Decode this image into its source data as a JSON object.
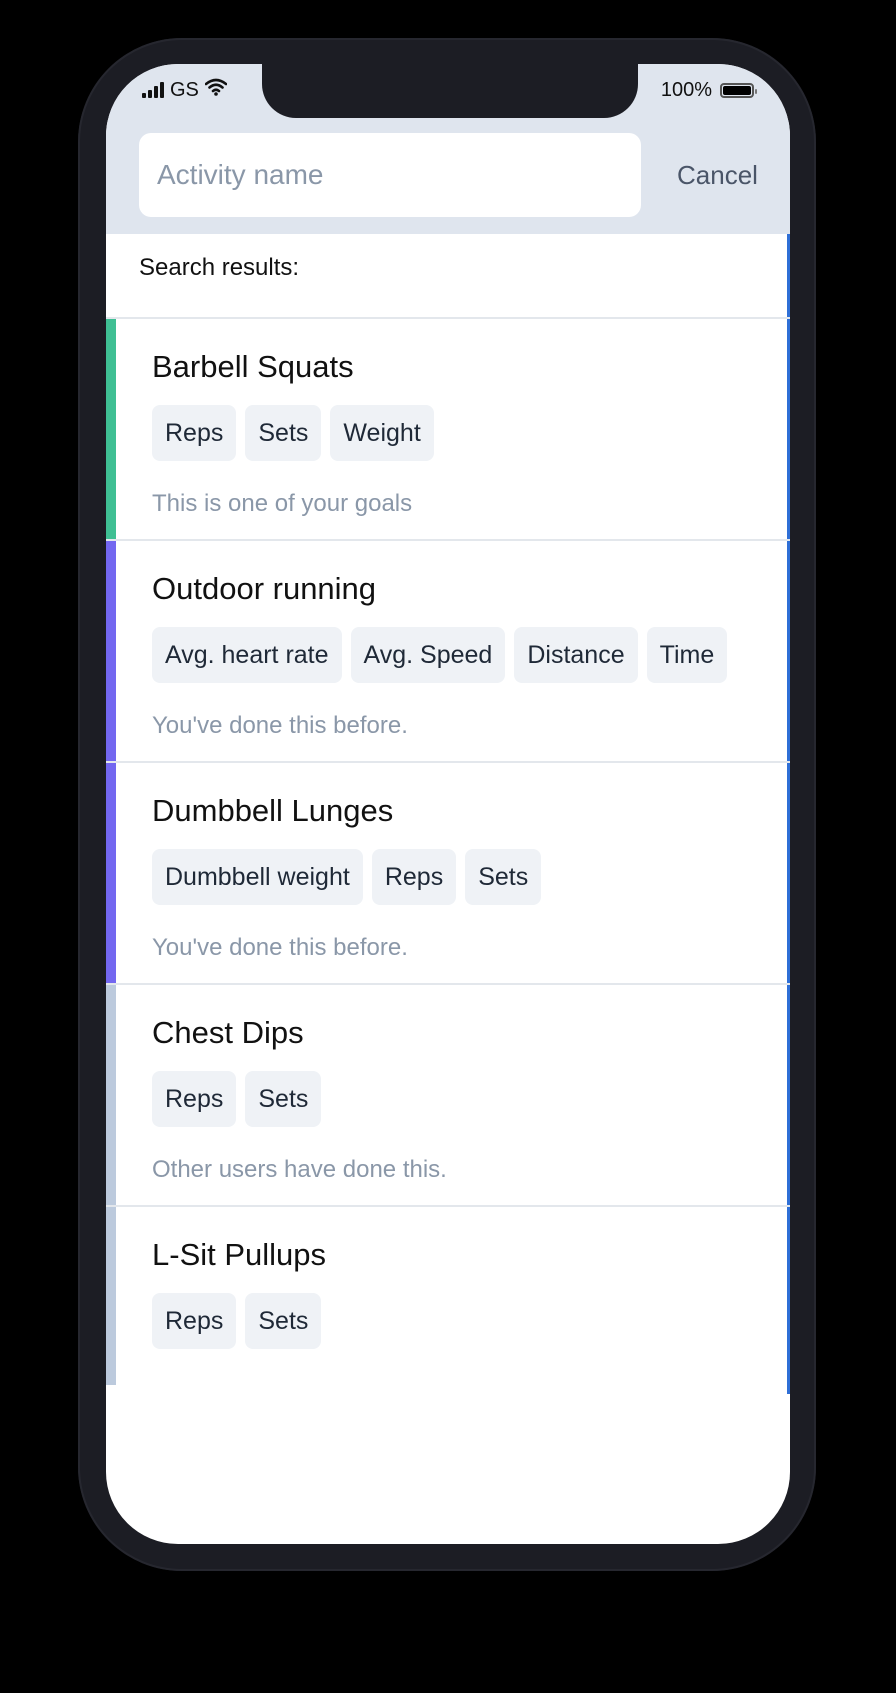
{
  "status_bar": {
    "carrier": "GS",
    "battery": "100%",
    "signal_icon": "cellular-signal-icon",
    "wifi_icon": "wifi-icon",
    "battery_icon": "battery-icon"
  },
  "search": {
    "placeholder": "Activity name",
    "value": "",
    "cancel_label": "Cancel"
  },
  "results_label": "Search results:",
  "colors": {
    "goal": "#3fbf93",
    "done_before": "#7367f0",
    "other_users": "#bccadd",
    "header_bg": "#dfe5ee",
    "tag_bg": "#eff2f6",
    "note_text": "#8a97a8"
  },
  "results": [
    {
      "title": "Barbell Squats",
      "tags": [
        "Reps",
        "Sets",
        "Weight"
      ],
      "note": "This is one of your goals",
      "status": "goal"
    },
    {
      "title": "Outdoor running",
      "tags": [
        "Avg. heart rate",
        "Avg. Speed",
        "Distance",
        "Time"
      ],
      "note": "You've done this before.",
      "status": "done_before"
    },
    {
      "title": "Dumbbell Lunges",
      "tags": [
        "Dumbbell weight",
        "Reps",
        "Sets"
      ],
      "note": "You've done this before.",
      "status": "done_before"
    },
    {
      "title": "Chest Dips",
      "tags": [
        "Reps",
        "Sets"
      ],
      "note": "Other users have done this.",
      "status": "other_users"
    },
    {
      "title": "L-Sit Pullups",
      "tags": [
        "Reps",
        "Sets"
      ],
      "note": "",
      "status": "other_users"
    }
  ]
}
